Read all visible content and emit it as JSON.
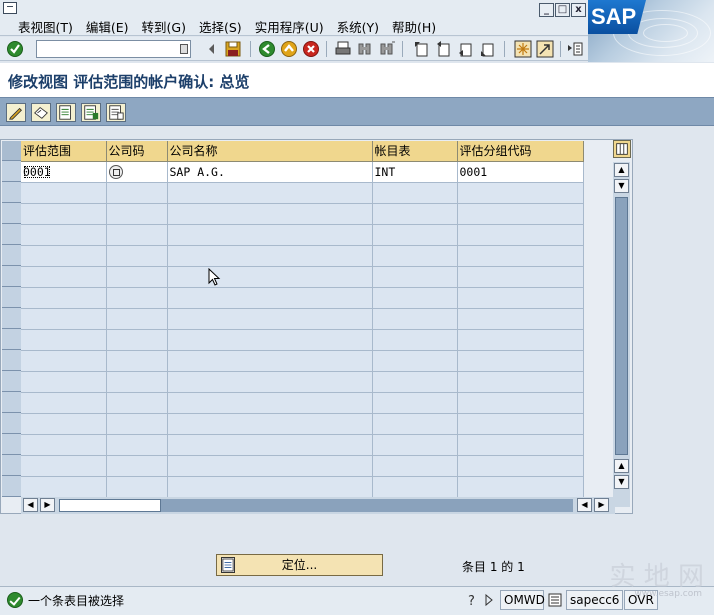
{
  "menubar": {
    "items": [
      "表视图(T)",
      "编辑(E)",
      "转到(G)",
      "选择(S)",
      "实用程序(U)",
      "系统(Y)",
      "帮助(H)"
    ],
    "window_controls": [
      "_",
      "□",
      "x"
    ],
    "logo": "SAP"
  },
  "toolbar": {
    "command_field_value": "",
    "icons": [
      "enter-icon",
      "save-icon",
      "back-icon",
      "exit-icon",
      "cancel-icon",
      "print-icon",
      "find-icon",
      "find-next-icon",
      "first-page-icon",
      "previous-page-icon",
      "next-page-icon",
      "last-page-icon",
      "create-session-icon",
      "shortcut-icon",
      "help-icon"
    ]
  },
  "page": {
    "title": "修改视图 评估范围的帐户确认: 总览"
  },
  "app_toolbar": {
    "icons": [
      "change-display-icon",
      "other-view-icon",
      "details-icon",
      "select-all-icon",
      "deselect-all-icon"
    ]
  },
  "grid": {
    "columns": [
      "评估范围",
      "公司码",
      "公司名称",
      "帐目表",
      "评估分组代码"
    ],
    "rows": [
      {
        "valuation_area": "0001",
        "company_code": "0001",
        "company_name": "SAP A.G.",
        "chart_of_accounts": "INT",
        "valuation_grouping_code": "0001"
      }
    ],
    "visible_row_count": 16
  },
  "footer": {
    "position_button_label": "定位...",
    "entries_text": "条目 1 的 1"
  },
  "statusbar": {
    "message": "一个条表目被选择",
    "system": "OMWD",
    "server": "sapecc6",
    "mode": "OVR"
  },
  "watermark": {
    "text": "实 地 网",
    "sub": "www.esap.com"
  },
  "colors": {
    "header": "#f0d78e",
    "app_toolbar": "#8ea7c2",
    "title": "#1c3f6a",
    "ok": "#2e8a2e"
  }
}
